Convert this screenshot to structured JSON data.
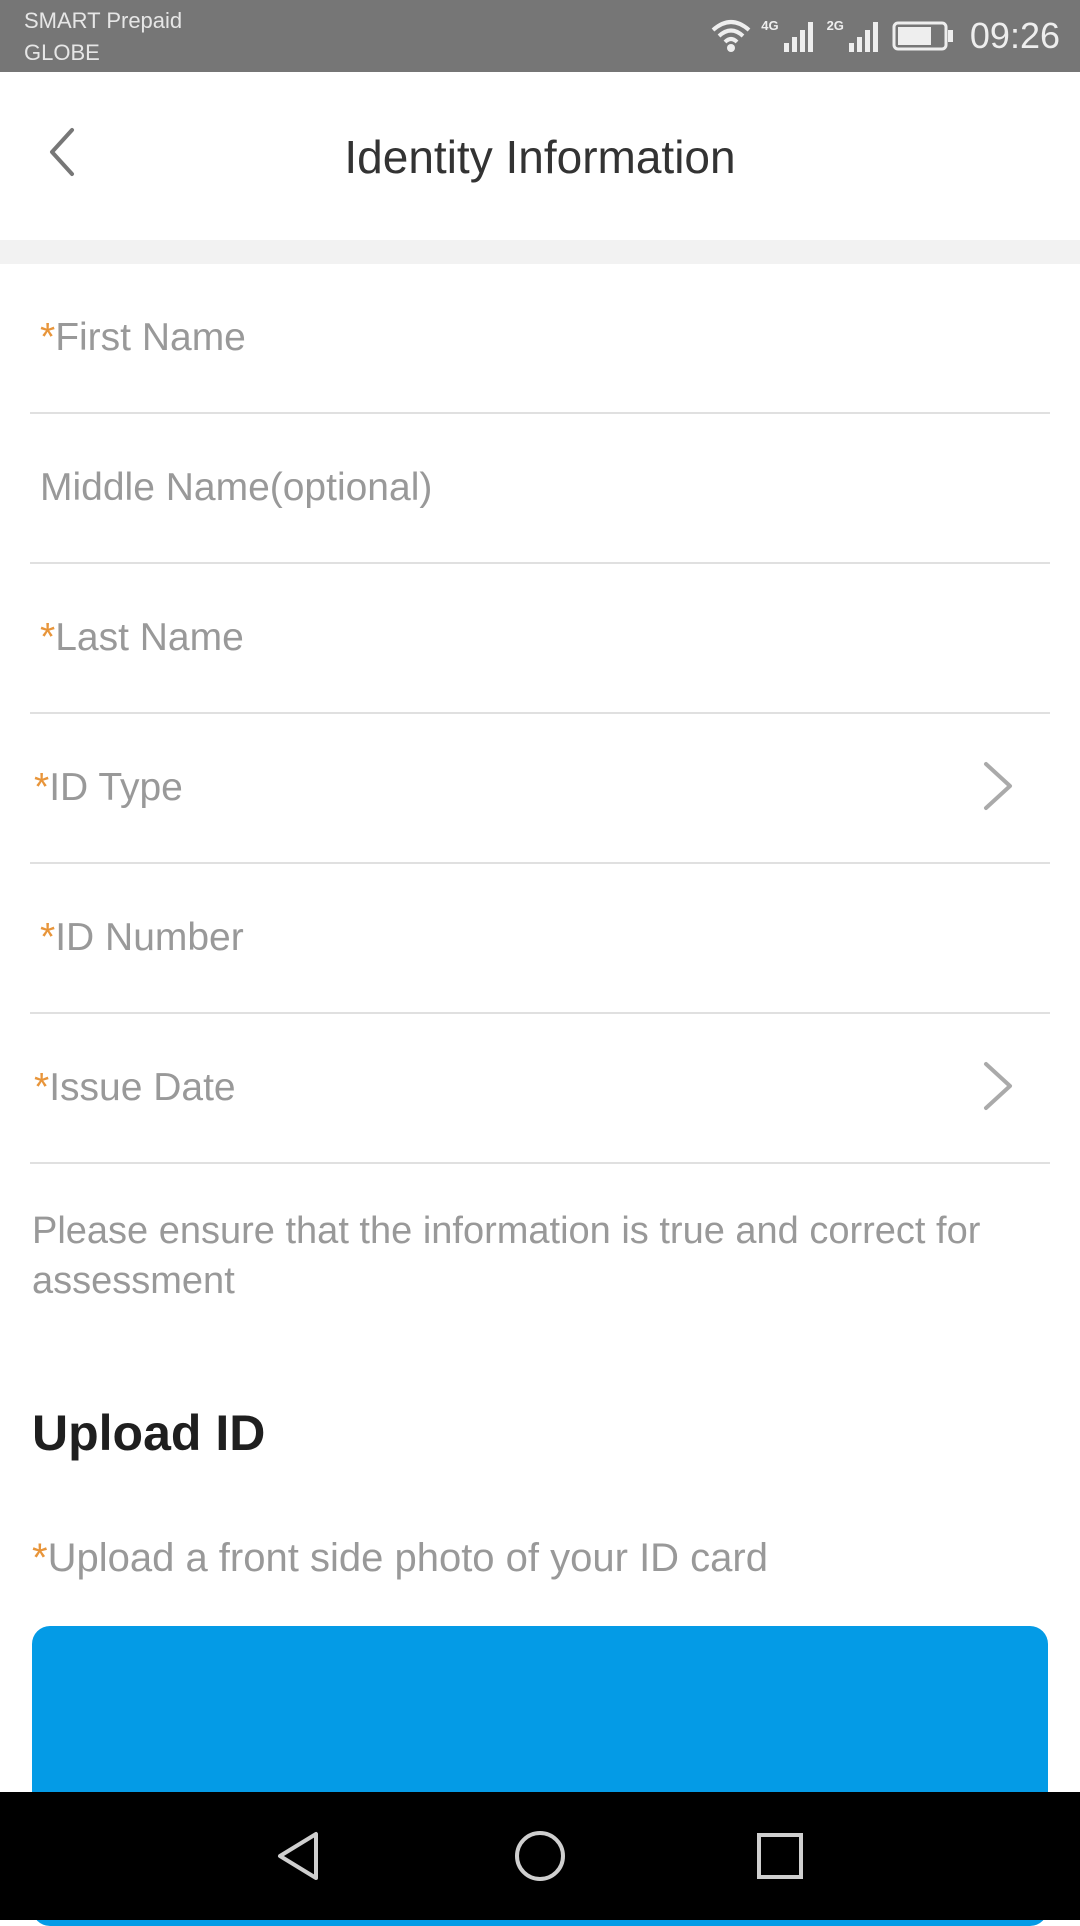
{
  "status_bar": {
    "carrier_1": "SMART Prepaid",
    "carrier_2": "GLOBE",
    "network_1": "4G",
    "network_2": "2G",
    "time": "09:26",
    "battery_level": 0.75,
    "icons": [
      "wifi-icon",
      "signal-4g-icon",
      "signal-2g-icon",
      "battery-icon"
    ]
  },
  "header": {
    "title": "Identity Information",
    "back_icon": "chevron-left-icon"
  },
  "form": {
    "required_marker": "*",
    "first_name": {
      "label": "First Name",
      "value": ""
    },
    "middle_name": {
      "label": "Middle Name(optional)",
      "value": ""
    },
    "last_name": {
      "label": "Last Name",
      "value": ""
    },
    "id_type": {
      "label": "ID Type",
      "value": ""
    },
    "id_number": {
      "label": "ID Number",
      "value": ""
    },
    "issue_date": {
      "label": "Issue Date",
      "value": ""
    },
    "notice": "Please ensure that the information is true and correct for assessment"
  },
  "upload": {
    "section_title": "Upload ID",
    "front_label": "Upload a front side photo of your ID card"
  },
  "nav_bar": {
    "buttons": [
      "back-triangle-icon",
      "home-circle-icon",
      "recents-square-icon"
    ]
  },
  "colors": {
    "status_bar": "#767676",
    "required": "#e8953a",
    "label": "#999999",
    "upload_box": "#049be6",
    "divider": "#e0e0e0"
  }
}
